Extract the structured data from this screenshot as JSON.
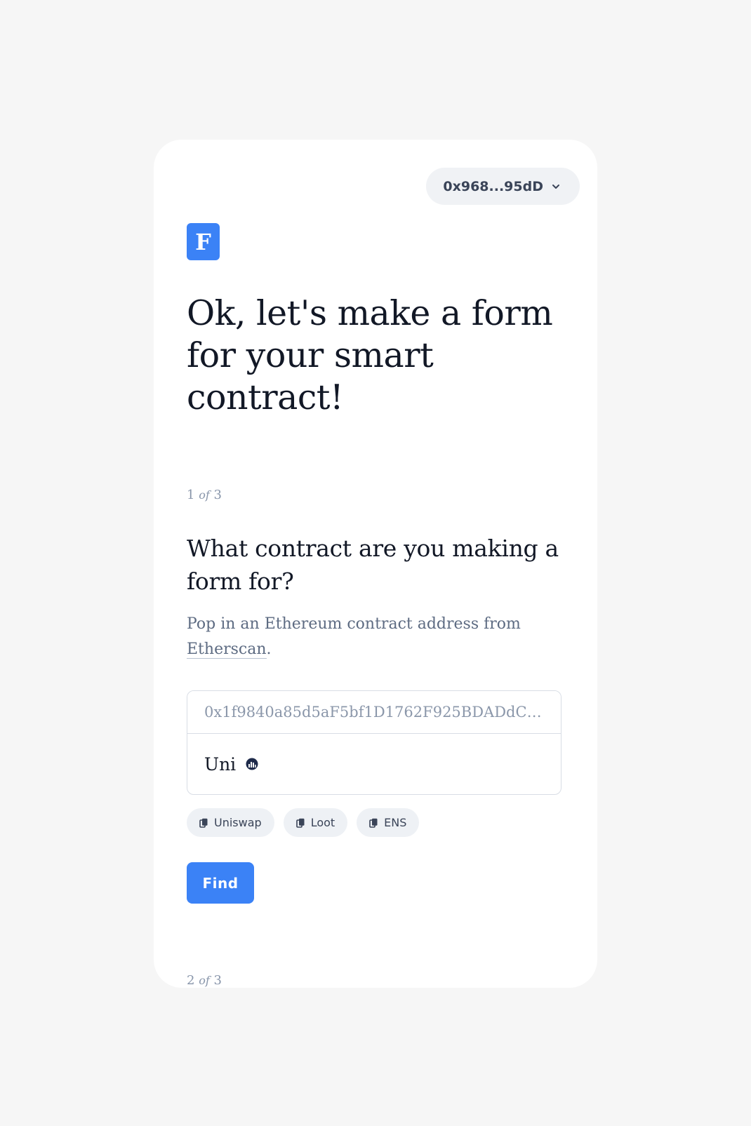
{
  "wallet": {
    "address": "0x968...95dD",
    "icon": "chevron-down-icon"
  },
  "logo": {
    "letter": "F"
  },
  "headline": "Ok, let's make a form for your smart contract!",
  "steps": {
    "current": {
      "num": "1",
      "of": "of",
      "total": "3"
    },
    "next": {
      "num": "2",
      "of": "of",
      "total": "3"
    }
  },
  "question": {
    "title": "What contract are you making a form for?",
    "help_prefix": "Pop in an Ethereum contract address from ",
    "help_link": "Etherscan",
    "help_suffix": "."
  },
  "contract_input": {
    "value": "0x1f9840a85d5aF5bf1D1762F925BDADdC4...",
    "resolved_name": "Uni",
    "resolved_icon": "uniswap-logo-icon"
  },
  "chips": [
    {
      "label": "Uniswap",
      "icon": "copy-icon"
    },
    {
      "label": "Loot",
      "icon": "copy-icon"
    },
    {
      "label": "ENS",
      "icon": "copy-icon"
    }
  ],
  "find_button": "Find",
  "colors": {
    "accent": "#3b82f6",
    "page_bg": "#f6f6f6",
    "card_bg": "#ffffff",
    "heading_text": "#121826",
    "muted_text": "#5d6b82"
  }
}
